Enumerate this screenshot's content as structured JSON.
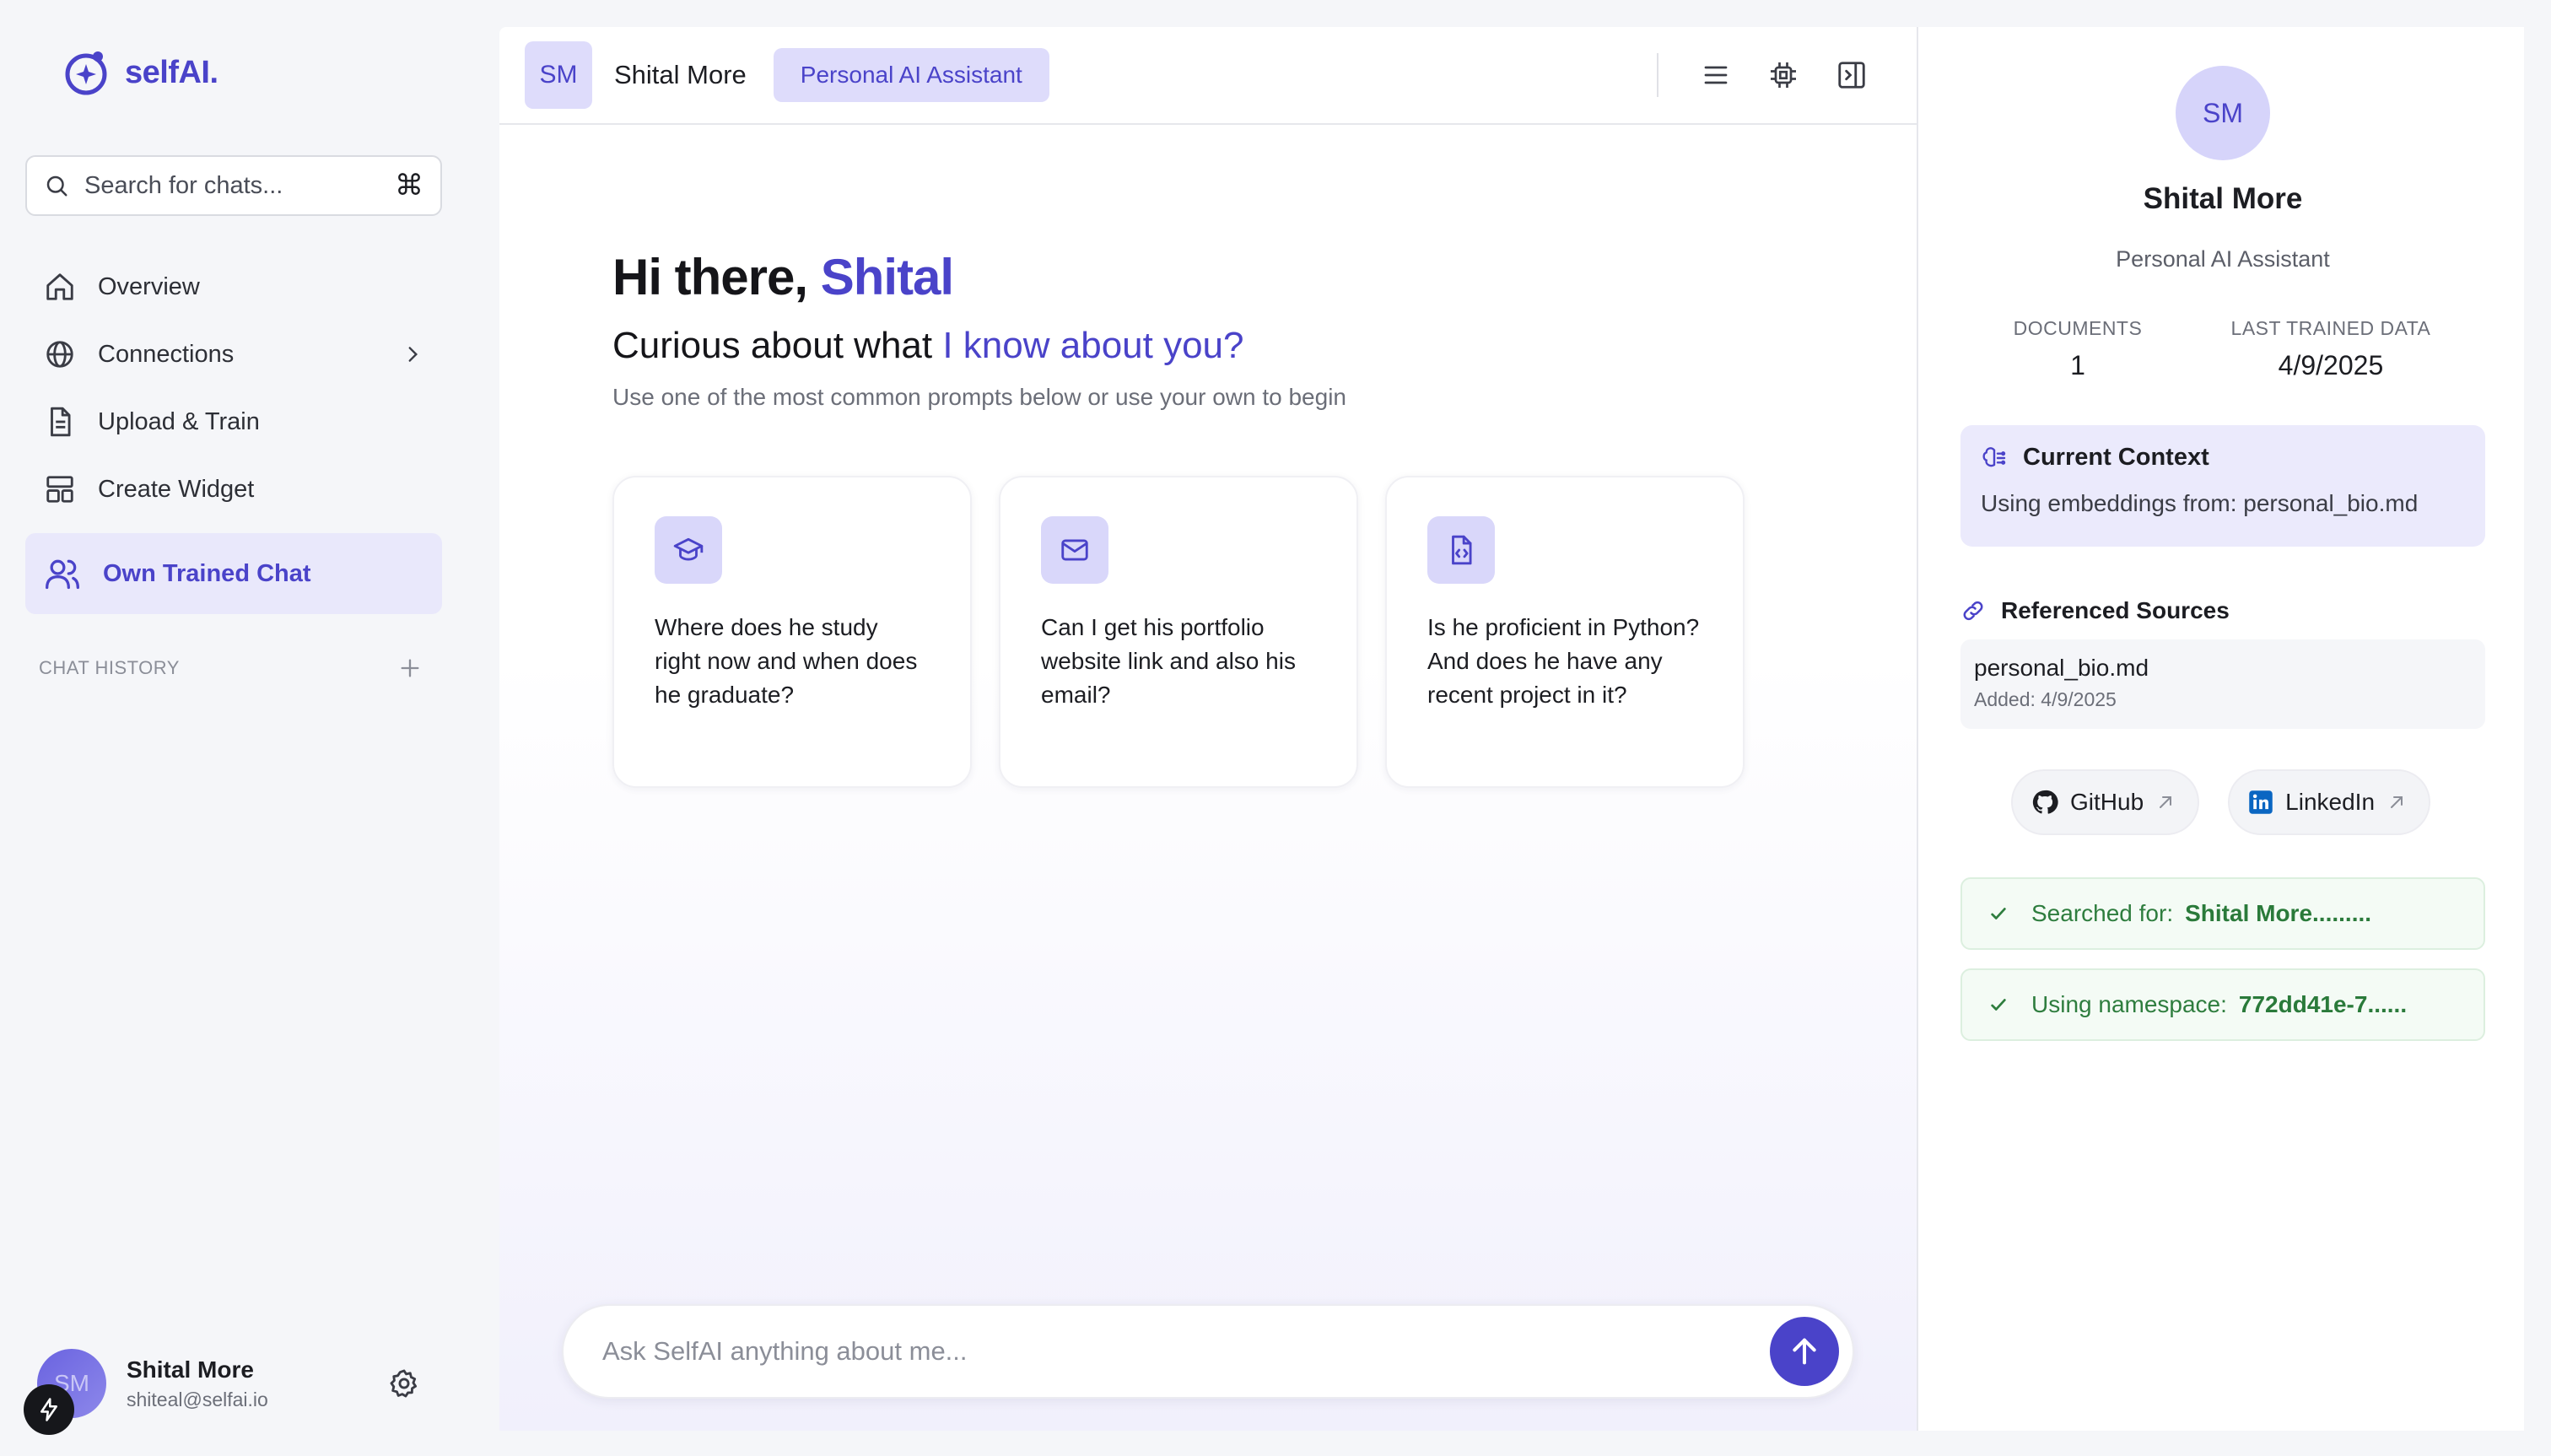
{
  "app": {
    "logo_text": "selfAI."
  },
  "search": {
    "placeholder": "Search for chats...",
    "shortcut": "⌘"
  },
  "sidebar": {
    "items": [
      {
        "label": "Overview"
      },
      {
        "label": "Connections"
      },
      {
        "label": "Upload & Train"
      },
      {
        "label": "Create Widget"
      },
      {
        "label": "Own Trained Chat"
      }
    ],
    "chat_history_label": "CHAT HISTORY"
  },
  "user": {
    "initials": "SM",
    "name": "Shital More",
    "email": "shiteal@selfai.io"
  },
  "header": {
    "initials": "SM",
    "name": "Shital More",
    "badge": "Personal AI Assistant"
  },
  "hero": {
    "greeting": "Hi there,",
    "greeting_name": "Shital",
    "subtitle_prefix": "Curious about what",
    "subtitle_accent": "I know about you?",
    "hint": "Use one of the most common prompts below or use your own to begin"
  },
  "prompts": [
    {
      "icon": "graduation-cap-icon",
      "text": "Where does he study right now and when does he graduate?"
    },
    {
      "icon": "mail-icon",
      "text": "Can I get his portfolio website link and also his email?"
    },
    {
      "icon": "code-file-icon",
      "text": "Is he proficient in Python? And does he have any recent project in it?"
    }
  ],
  "composer": {
    "placeholder": "Ask SelfAI anything about me..."
  },
  "profile": {
    "initials": "SM",
    "name": "Shital More",
    "role": "Personal AI Assistant",
    "stats": [
      {
        "label": "DOCUMENTS",
        "value": "1"
      },
      {
        "label": "LAST TRAINED DATA",
        "value": "4/9/2025"
      }
    ],
    "context": {
      "title": "Current Context",
      "body": "Using embeddings from: personal_bio.md"
    },
    "sources_title": "Referenced Sources",
    "sources": [
      {
        "name": "personal_bio.md",
        "added": "Added: 4/9/2025"
      }
    ],
    "links": [
      {
        "label": "GitHub"
      },
      {
        "label": "LinkedIn"
      }
    ],
    "statuses": [
      {
        "key": "Searched for:",
        "value": "Shital More........."
      },
      {
        "key": "Using namespace:",
        "value": "772dd41e-7......"
      }
    ]
  },
  "colors": {
    "accent": "#4a43c9",
    "accent_soft": "#dedcfb",
    "success": "#2e7d3e"
  }
}
